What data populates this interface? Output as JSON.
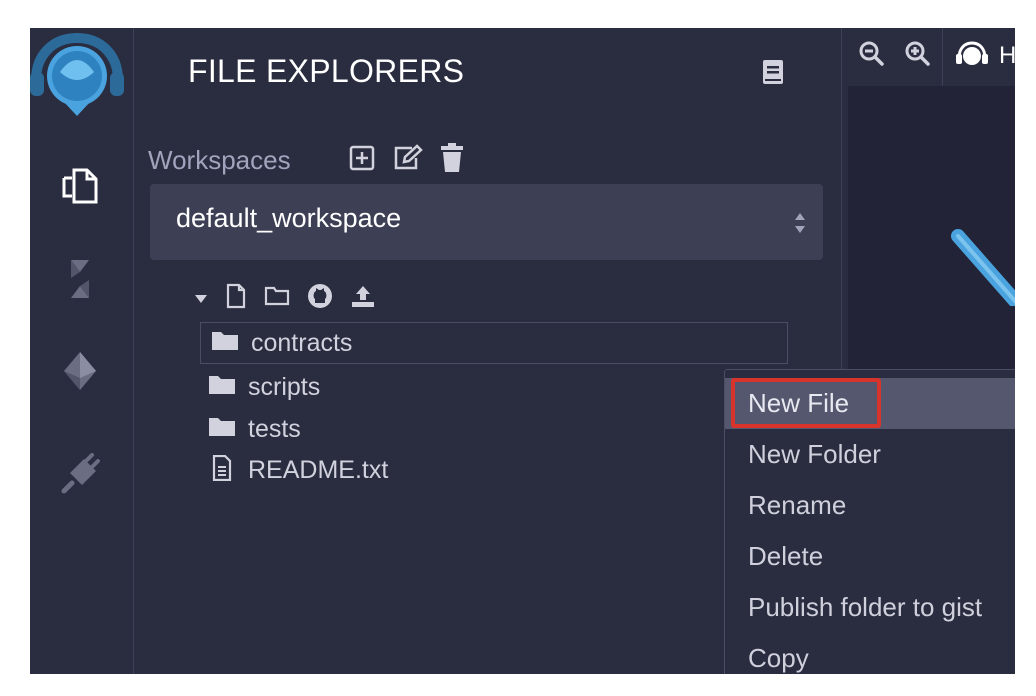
{
  "panel": {
    "title": "FILE EXPLORERS",
    "header_icon": "book-icon"
  },
  "rail": {
    "logo": "remix-logo",
    "items": [
      {
        "icon": "file-explorer-icon",
        "active": true
      },
      {
        "icon": "solidity-compiler-icon"
      },
      {
        "icon": "deploy-run-icon"
      },
      {
        "icon": "plugin-manager-icon"
      }
    ]
  },
  "workspaces": {
    "label": "Workspaces",
    "actions": [
      "create-workspace-icon",
      "rename-workspace-icon",
      "delete-workspace-icon"
    ],
    "selected": "default_workspace"
  },
  "tree_toolbar": [
    "caret-down-icon",
    "new-file-icon",
    "new-folder-icon",
    "github-icon",
    "upload-icon"
  ],
  "tree": [
    {
      "type": "folder",
      "name": "contracts",
      "selected": true
    },
    {
      "type": "folder",
      "name": "scripts"
    },
    {
      "type": "folder",
      "name": "tests"
    },
    {
      "type": "file",
      "name": "README.txt"
    }
  ],
  "editor": {
    "tabs": [
      "zoom-out-icon",
      "zoom-in-icon"
    ],
    "home_tab_text": "H"
  },
  "context_menu": {
    "items": [
      "New File",
      "New Folder",
      "Rename",
      "Delete",
      "Publish folder to gist",
      "Copy"
    ],
    "highlighted": "New File"
  },
  "colors": {
    "background": "#2a2c3f",
    "highlight": "#54576e",
    "callout": "#d9342b",
    "accent_blue": "#4aa3df"
  }
}
